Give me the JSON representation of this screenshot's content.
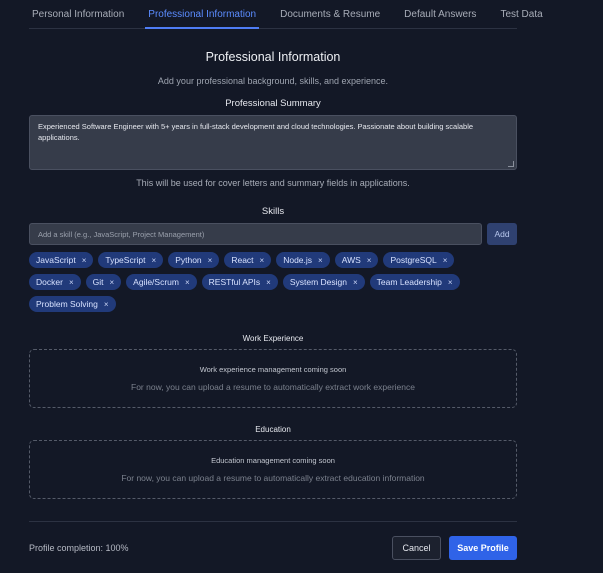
{
  "tabs": [
    {
      "label": "Personal Information"
    },
    {
      "label": "Professional Information"
    },
    {
      "label": "Documents & Resume"
    },
    {
      "label": "Default Answers"
    },
    {
      "label": "Test Data"
    }
  ],
  "page": {
    "title": "Professional Information",
    "subtitle": "Add your professional background, skills, and experience."
  },
  "summary": {
    "label": "Professional Summary",
    "value": "Experienced Software Engineer with 5+ years in full-stack development and cloud technologies. Passionate about building scalable applications.",
    "hint": "This will be used for cover letters and summary fields in applications."
  },
  "skills": {
    "label": "Skills",
    "placeholder": "Add a skill (e.g., JavaScript, Project Management)",
    "add_label": "Add",
    "remove_glyph": "×",
    "items": [
      "JavaScript",
      "TypeScript",
      "Python",
      "React",
      "Node.js",
      "AWS",
      "PostgreSQL",
      "Docker",
      "Git",
      "Agile/Scrum",
      "RESTful APIs",
      "System Design",
      "Team Leadership",
      "Problem Solving"
    ]
  },
  "work": {
    "label": "Work Experience",
    "title": "Work experience management coming soon",
    "desc": "For now, you can upload a resume to automatically extract work experience"
  },
  "education": {
    "label": "Education",
    "title": "Education management coming soon",
    "desc": "For now, you can upload a resume to automatically extract education information"
  },
  "footer": {
    "completion": "Profile completion: 100%",
    "cancel_label": "Cancel",
    "save_label": "Save Profile"
  },
  "colors": {
    "background": "#131826",
    "accent": "#2f63e8",
    "chip": "#213a7a"
  }
}
